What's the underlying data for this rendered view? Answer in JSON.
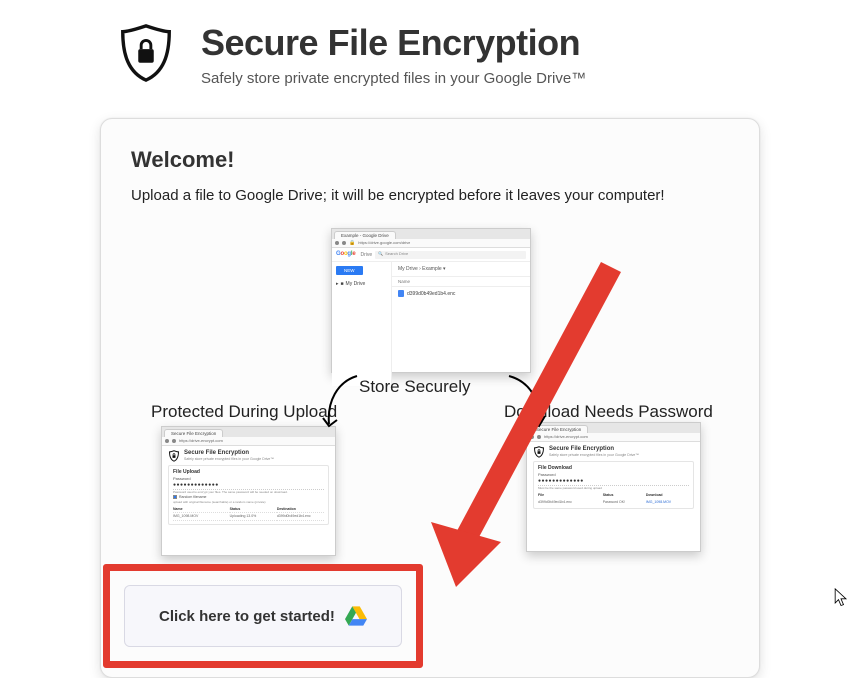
{
  "header": {
    "title": "Secure File Encryption",
    "subtitle": "Safely store private encrypted files in your Google Drive™"
  },
  "card": {
    "welcome": "Welcome!",
    "intro": "Upload a file to Google Drive; it will be encrypted before it leaves your computer!"
  },
  "captions": {
    "store": "Store Securely",
    "upload": "Protected During Upload",
    "download": "Download Needs Password"
  },
  "drive": {
    "tab": "Example - Google Drive",
    "url": "https://drive.google.com/drive",
    "brand_drive": "Drive",
    "search_placeholder": "Search Drive",
    "new_btn": "NEW",
    "sidebar_mydrive": "My Drive",
    "crumbs": "My Drive  ›  Example ▾",
    "col_name": "Name",
    "file_name": "d399d0b49ed1b4.enc"
  },
  "upload": {
    "tab": "Secure File Encryption",
    "url": "https://drive-encrypt.com",
    "title": "Secure File Encryption",
    "subtitle": "Safely store private encrypted files in your Google Drive™",
    "panel": "File Upload",
    "pwd_label": "Password",
    "pwd_dots": "●●●●●●●●●●●●●",
    "hint": "Password used to encrypt your files. The same password will be needed on download.",
    "checkbox": "Random filename",
    "checkbox_hint": "upload with original filename (searchable) or a random name (private)",
    "col_name": "Name",
    "col_status": "Status",
    "col_dest": "Destination",
    "row_name": "IMG_1098.MOV",
    "row_status": "Uploading 13.0%",
    "row_dest": "d399d0b49ed1b4.enc"
  },
  "download": {
    "tab": "Secure File Encryption",
    "url": "https://drive-encrypt.com",
    "title": "Secure File Encryption",
    "subtitle": "Safely store private encrypted files in your Google Drive™",
    "panel": "File Download",
    "pwd_label": "Password",
    "pwd_dots": "●●●●●●●●●●●●●",
    "hint": "Must be the same password used during upload",
    "col_file": "File",
    "col_status": "Status",
    "col_dl": "Download",
    "row_file": "d399d0b49ed1b4.enc",
    "row_status": "Password OK!",
    "row_dl": "IMG_1098.MOV"
  },
  "cta": {
    "label": "Click here to get started!"
  }
}
